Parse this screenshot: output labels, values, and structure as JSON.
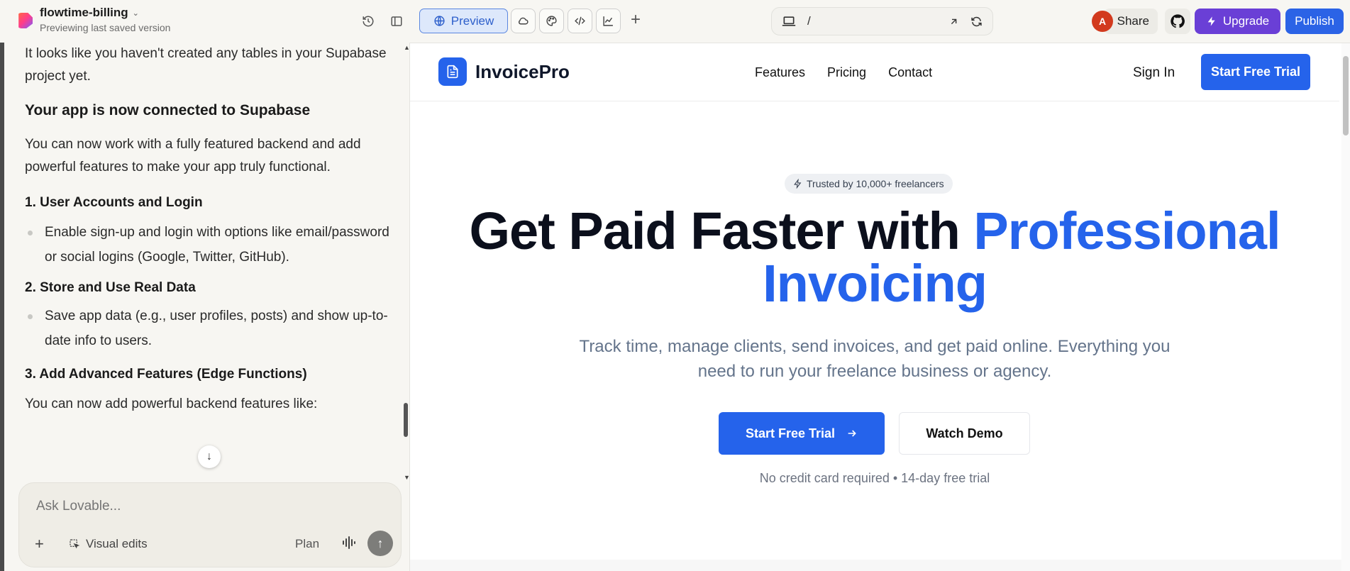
{
  "header": {
    "project_name": "flowtime-billing",
    "project_subtitle": "Previewing last saved version",
    "preview_label": "Preview",
    "url_path": "/",
    "avatar_initial": "A",
    "share_label": "Share",
    "upgrade_label": "Upgrade",
    "publish_label": "Publish"
  },
  "chat": {
    "intro": "It looks like you haven't created any tables in your Supabase project yet.",
    "heading": "Your app is now connected to Supabase",
    "body": "You can now work with a fully featured backend and add powerful features to make your app truly functional.",
    "sections": [
      {
        "title": "1. User Accounts and Login",
        "bullet": "Enable sign-up and login with options like email/password or social logins (Google, Twitter, GitHub)."
      },
      {
        "title": "2. Store and Use Real Data",
        "bullet": "Save app data (e.g., user profiles, posts) and show up-to-date info to users."
      },
      {
        "title": "3. Add Advanced Features (Edge Functions)"
      }
    ],
    "trailing": "You can now add powerful backend features like:",
    "composer_placeholder": "Ask Lovable...",
    "visual_edits_label": "Visual edits",
    "plan_label": "Plan"
  },
  "site": {
    "brand": "InvoicePro",
    "nav": [
      "Features",
      "Pricing",
      "Contact"
    ],
    "sign_in": "Sign In",
    "trial_top": "Start Free Trial",
    "badge": "Trusted by 10,000+ freelancers",
    "hero_line1": "Get Paid Faster with ",
    "hero_highlight": "Professional Invoicing",
    "hero_sub": "Track time, manage clients, send invoices, and get paid online. Everything you need to run your freelance business or agency.",
    "cta_primary": "Start Free Trial",
    "cta_secondary": "Watch Demo",
    "fineprint": "No credit card required • 14-day free trial"
  },
  "colors": {
    "accent_blue": "#2563eb",
    "upgrade_purple": "#6a3fd6",
    "avatar_red": "#d23a1e"
  }
}
